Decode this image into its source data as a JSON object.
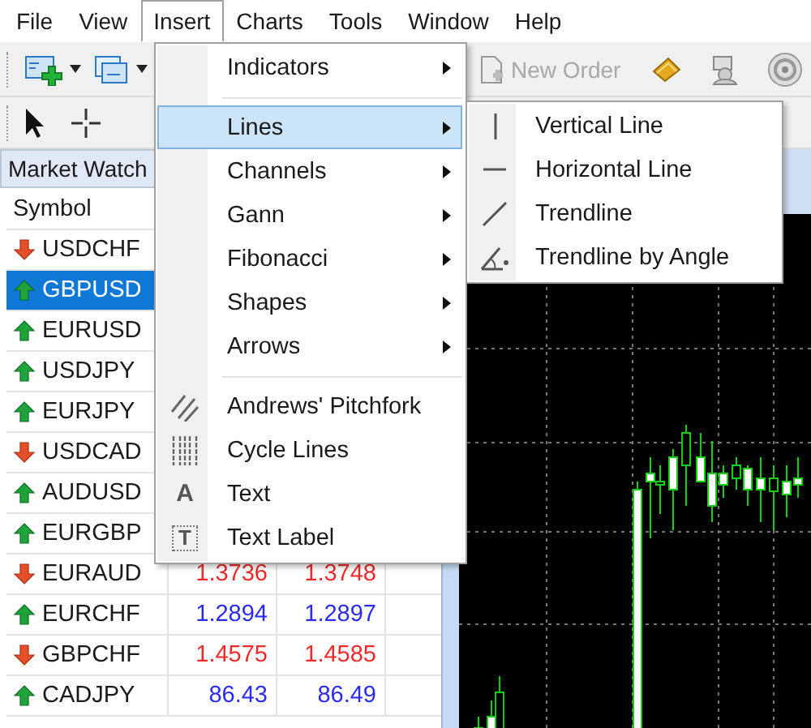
{
  "menu_bar": [
    {
      "label": "File",
      "selected": false
    },
    {
      "label": "View",
      "selected": false
    },
    {
      "label": "Insert",
      "selected": true
    },
    {
      "label": "Charts",
      "selected": false
    },
    {
      "label": "Tools",
      "selected": false
    },
    {
      "label": "Window",
      "selected": false
    },
    {
      "label": "Help",
      "selected": false
    }
  ],
  "toolbar": {
    "new_order": {
      "label": "New Order",
      "disabled": true
    }
  },
  "market_watch": {
    "title": "Market Watch",
    "columns": [
      "Symbol"
    ],
    "rows": [
      {
        "symbol": "USDCHF",
        "kind": "down",
        "selected": false
      },
      {
        "symbol": "GBPUSD",
        "kind": "up",
        "selected": true
      },
      {
        "symbol": "EURUSD",
        "kind": "up",
        "selected": false
      },
      {
        "symbol": "USDJPY",
        "kind": "up",
        "selected": false
      },
      {
        "symbol": "EURJPY",
        "kind": "up",
        "selected": false
      },
      {
        "symbol": "USDCAD",
        "kind": "down",
        "selected": false
      },
      {
        "symbol": "AUDUSD",
        "kind": "up",
        "selected": false
      },
      {
        "symbol": "EURGBP",
        "kind": "up",
        "selected": false
      },
      {
        "symbol": "EURAUD",
        "kind": "down",
        "selected": false,
        "bid": "1.3736",
        "ask": "1.3748"
      },
      {
        "symbol": "EURCHF",
        "kind": "up",
        "selected": false,
        "bid": "1.2894",
        "ask": "1.2897"
      },
      {
        "symbol": "GBPCHF",
        "kind": "down",
        "selected": false,
        "bid": "1.4575",
        "ask": "1.4585"
      },
      {
        "symbol": "CADJPY",
        "kind": "up",
        "selected": false,
        "bid": "86.43",
        "ask": "86.49"
      }
    ]
  },
  "insert_menu": {
    "items": [
      {
        "kind": "item",
        "label": "Indicators",
        "has_submenu": true,
        "selected": false
      },
      {
        "kind": "separator"
      },
      {
        "kind": "item",
        "label": "Lines",
        "has_submenu": true,
        "selected": true
      },
      {
        "kind": "item",
        "label": "Channels",
        "has_submenu": true,
        "selected": false
      },
      {
        "kind": "item",
        "label": "Gann",
        "has_submenu": true,
        "selected": false
      },
      {
        "kind": "item",
        "label": "Fibonacci",
        "has_submenu": true,
        "selected": false
      },
      {
        "kind": "item",
        "label": "Shapes",
        "has_submenu": true,
        "selected": false
      },
      {
        "kind": "item",
        "label": "Arrows",
        "has_submenu": true,
        "selected": false
      },
      {
        "kind": "separator"
      },
      {
        "kind": "pitchfork",
        "label": "Andrews' Pitchfork",
        "has_submenu": false,
        "selected": false
      },
      {
        "kind": "cycle",
        "label": "Cycle Lines",
        "has_submenu": false,
        "selected": false
      },
      {
        "kind": "glyph",
        "icon_text": "A",
        "label": "Text",
        "has_submenu": false,
        "selected": false
      },
      {
        "kind": "boxed-glyph",
        "icon_text": "T",
        "label": "Text Label",
        "has_submenu": false,
        "selected": false
      }
    ]
  },
  "lines_submenu": {
    "items": [
      {
        "kind": "vertical",
        "label": "Vertical Line"
      },
      {
        "kind": "horizontal",
        "label": "Horizontal Line"
      },
      {
        "kind": "trend",
        "label": "Trendline"
      },
      {
        "kind": "angle",
        "label": "Trendline by Angle"
      }
    ]
  }
}
